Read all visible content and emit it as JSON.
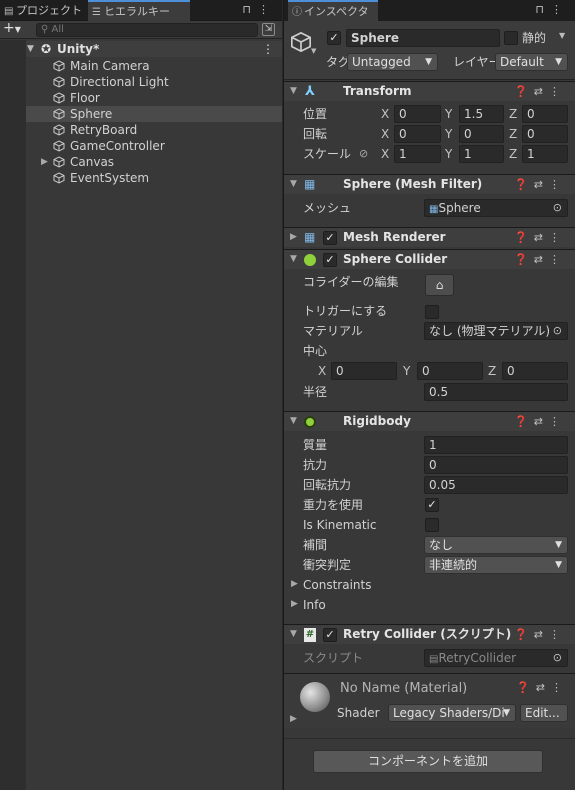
{
  "hierarchy": {
    "tabs": {
      "project": "プロジェクト",
      "hierarchy": "ヒエラルキー"
    },
    "search_placeholder": "All",
    "scene_name": "Unity*",
    "items": [
      "Main Camera",
      "Directional Light",
      "Floor",
      "Sphere",
      "RetryBoard",
      "GameController",
      "Canvas",
      "EventSystem"
    ],
    "selected_item": "Sphere"
  },
  "inspector": {
    "tab": "インスペクター",
    "object": {
      "name": "Sphere",
      "static_label": "静的",
      "tag_label": "タグ",
      "tag_value": "Untagged",
      "layer_label": "レイヤー",
      "layer_value": "Default"
    },
    "transform": {
      "title": "Transform",
      "position_label": "位置",
      "rotation_label": "回転",
      "scale_label": "スケール",
      "axes": {
        "x": "X",
        "y": "Y",
        "z": "Z"
      },
      "position": [
        "0",
        "1.5",
        "0"
      ],
      "rotation": [
        "0",
        "0",
        "0"
      ],
      "scale": [
        "1",
        "1",
        "1"
      ]
    },
    "mesh_filter": {
      "title": "Sphere (Mesh Filter)",
      "mesh_label": "メッシュ",
      "mesh_value": "Sphere"
    },
    "mesh_renderer": {
      "title": "Mesh Renderer"
    },
    "sphere_collider": {
      "title": "Sphere Collider",
      "edit_label": "コライダーの編集",
      "trigger_label": "トリガーにする",
      "material_label": "マテリアル",
      "material_value": "なし (物理マテリアル)",
      "center_label": "中心",
      "center": [
        "0",
        "0",
        "0"
      ],
      "radius_label": "半径",
      "radius_value": "0.5"
    },
    "rigidbody": {
      "title": "Rigidbody",
      "mass_label": "質量",
      "mass_value": "1",
      "drag_label": "抗力",
      "drag_value": "0",
      "angular_drag_label": "回転抗力",
      "angular_drag_value": "0.05",
      "gravity_label": "重力を使用",
      "kinematic_label": "Is Kinematic",
      "interpolate_label": "補間",
      "interpolate_value": "なし",
      "collision_label": "衝突判定",
      "collision_value": "非連続的",
      "constraints_label": "Constraints",
      "info_label": "Info"
    },
    "retry_collider": {
      "title": "Retry Collider (スクリプト)",
      "script_label": "スクリプト",
      "script_value": "RetryCollider"
    },
    "material": {
      "name": "No Name (Material)",
      "shader_label": "Shader",
      "shader_value": "Legacy Shaders/Di",
      "edit_label": "Edit..."
    },
    "add_component_label": "コンポーネントを追加"
  },
  "colors": {
    "accent_blue": "#4d90d8",
    "collider_green": "#8fd13a",
    "panel": "#383838"
  }
}
